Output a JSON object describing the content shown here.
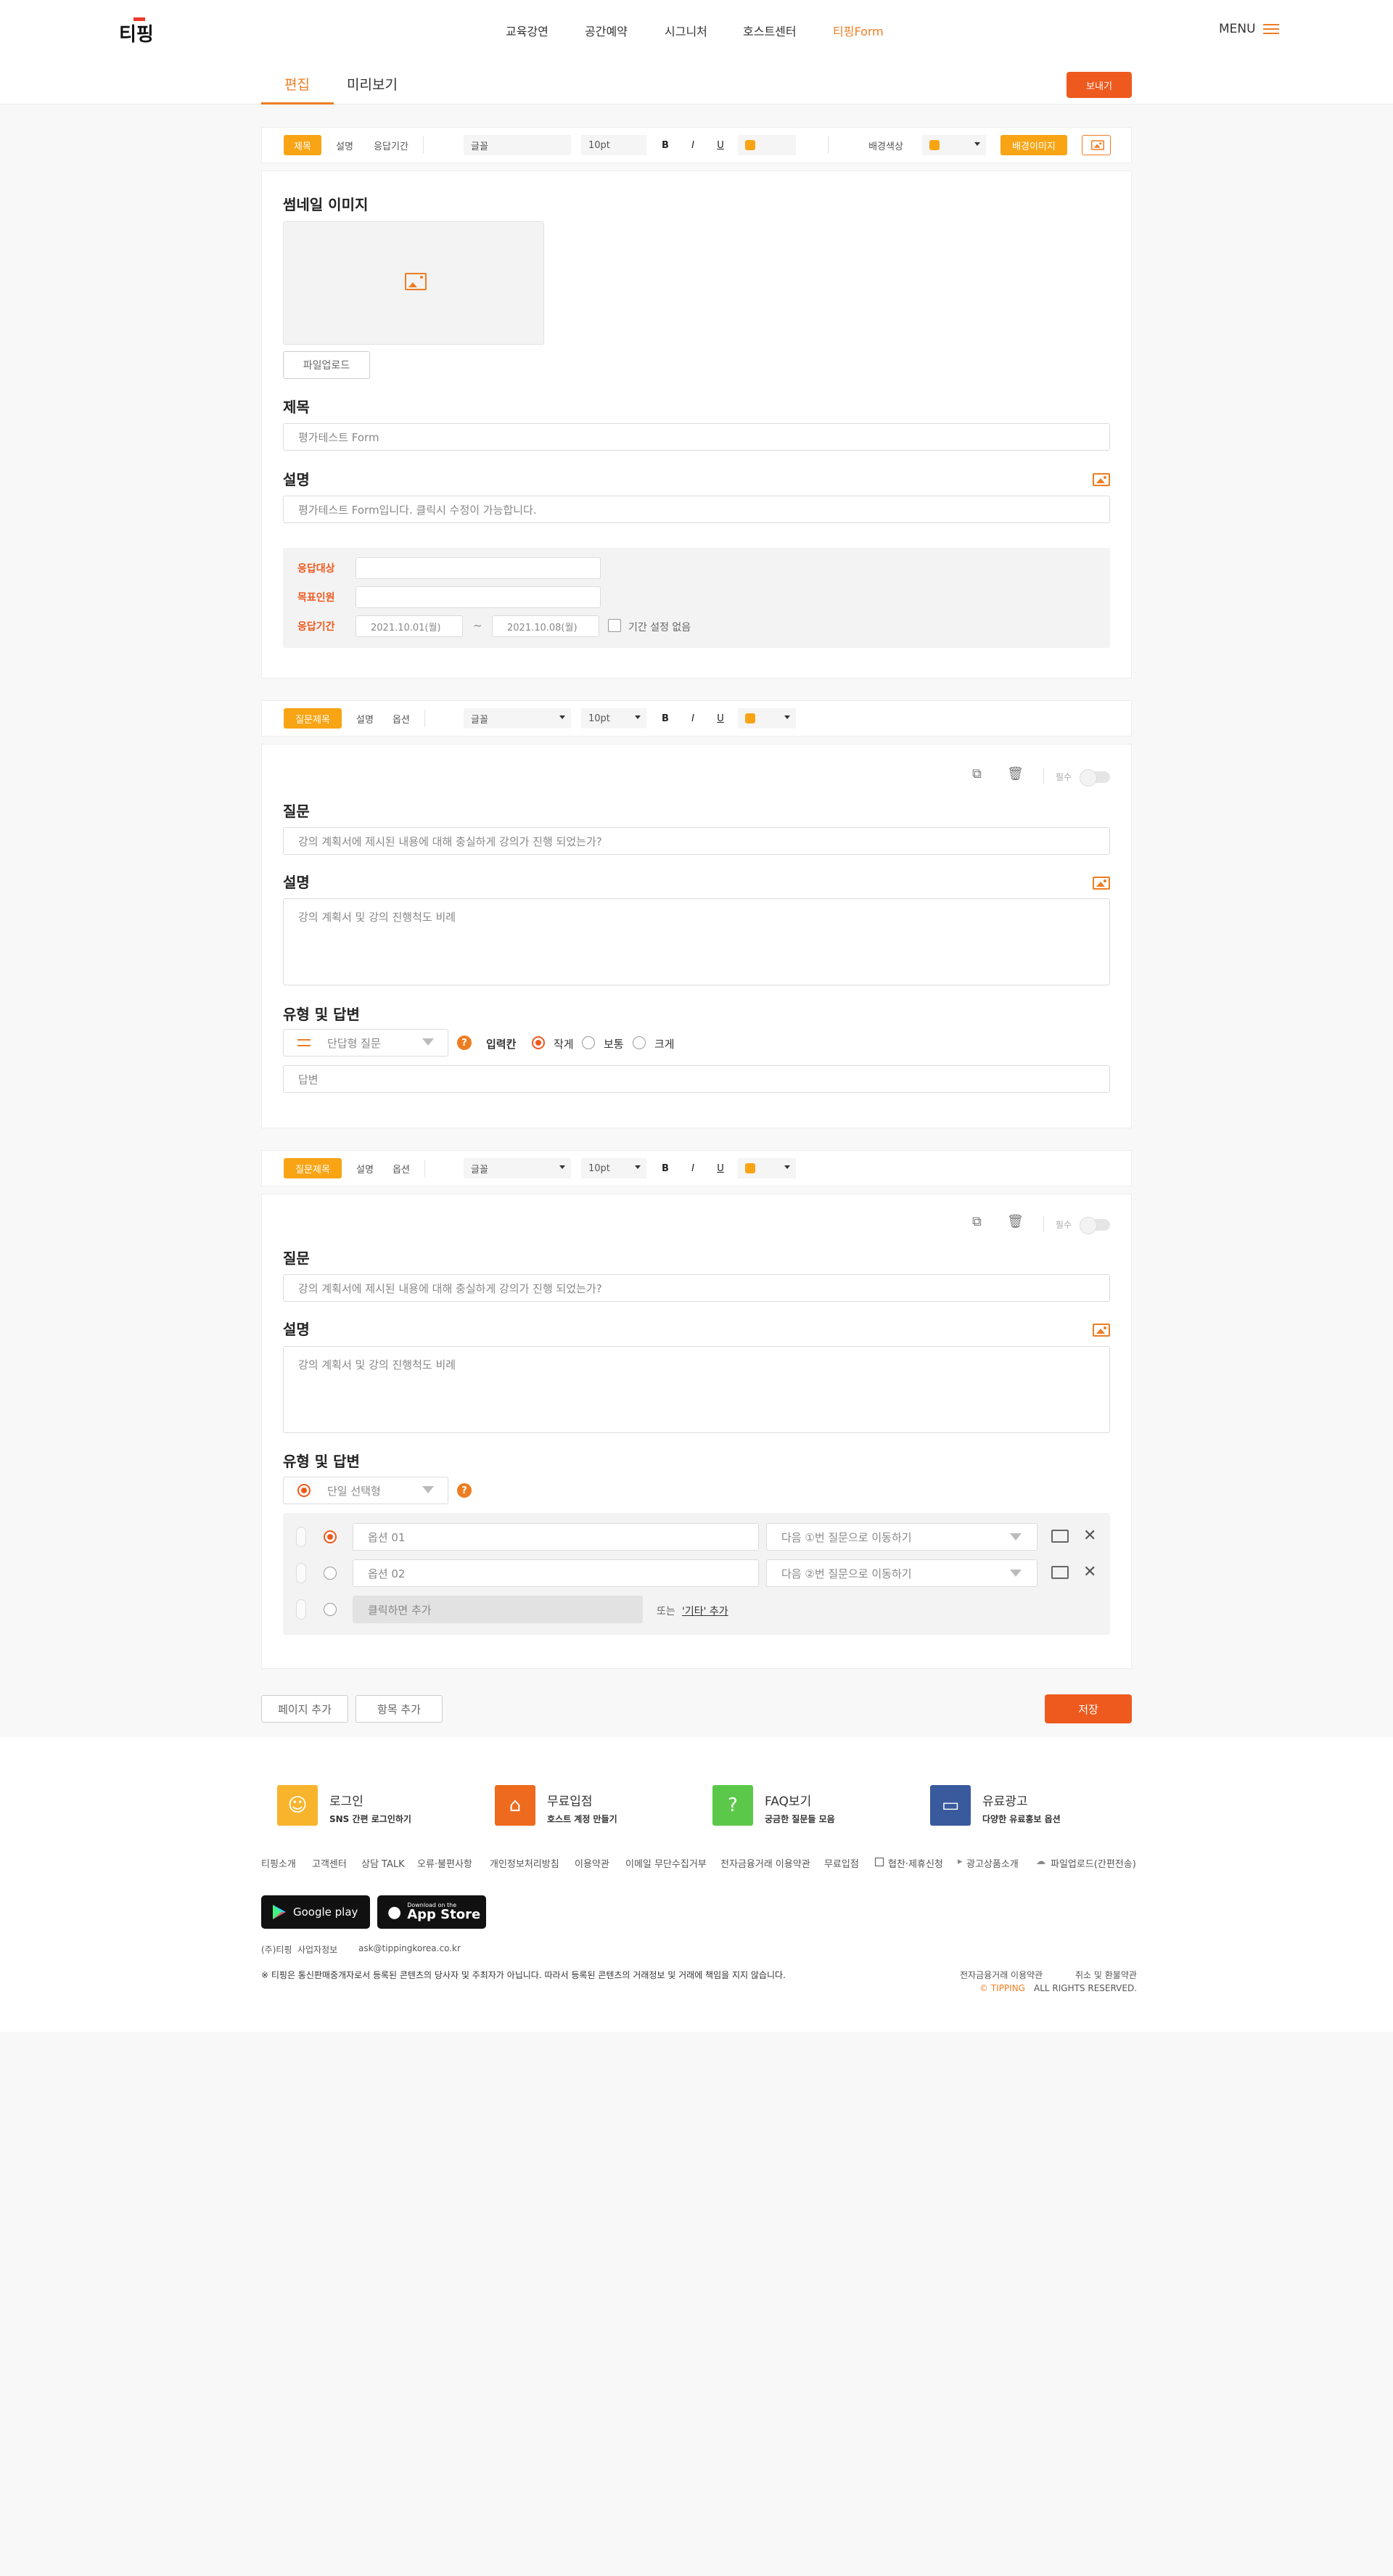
{
  "header": {
    "logo_text": "티핑",
    "nav": [
      "교육강연",
      "공간예약",
      "시그니처",
      "호스트센터",
      "티핑Form"
    ],
    "menu_label": "MENU"
  },
  "tabs": {
    "edit": "편집",
    "preview": "미리보기"
  },
  "send_button": "보내기",
  "form_toolbar": {
    "tabs": [
      "제목",
      "설명",
      "응답기간"
    ],
    "font": "글꼴",
    "size": "10pt",
    "bold": "B",
    "italic": "I",
    "underline": "U",
    "bg_color_label": "배경색상",
    "bg_image_button": "배경이미지"
  },
  "form_info": {
    "thumbnail_label": "썸네일 이미지",
    "upload_button": "파일업로드",
    "title_label": "제목",
    "title_value": "평가테스트 Form",
    "desc_label": "설명",
    "desc_value": "평가테스트 Form입니다. 클릭시 수정이 가능합니다.",
    "target_label": "응답대상",
    "goal_label": "목표인원",
    "period_label": "응답기간",
    "start_date": "2021.10.01(월)",
    "tilde": "~",
    "end_date": "2021.10.08(월)",
    "no_period_label": "기간 설정 없음"
  },
  "question_toolbar": {
    "tabs": [
      "질문제목",
      "설명",
      "옵션"
    ],
    "font": "글꼴",
    "size": "10pt",
    "bold": "B",
    "italic": "I",
    "underline": "U"
  },
  "question1": {
    "required_label": "필수",
    "question_label": "질문",
    "question_placeholder": "강의 계획서에 제시된 내용에 대해 충실하게 강의가 진행 되었는가?",
    "desc_label": "설명",
    "desc_placeholder": "강의 계획서 및 강의 진행척도 비례",
    "type_label": "유형 및 답변",
    "type_value": "단답형 질문",
    "input_label": "입력칸",
    "size_options": [
      "작게",
      "보통",
      "크게"
    ],
    "selected_size": "작게",
    "answer_placeholder": "답변"
  },
  "question2": {
    "required_label": "필수",
    "question_label": "질문",
    "question_placeholder": "강의 계획서에 제시된 내용에 대해 충실하게 강의가 진행 되었는가?",
    "desc_label": "설명",
    "desc_placeholder": "강의 계획서 및 강의 진행척도 비례",
    "type_label": "유형 및 답변",
    "type_value": "단일 선택형",
    "options": [
      {
        "label": "옵션 01",
        "goto": "다음 ①번 질문으로 이동하기",
        "selected": true
      },
      {
        "label": "옵션 02",
        "goto": "다음 ②번 질문으로 이동하기",
        "selected": false
      }
    ],
    "add_option_placeholder": "클릭하면 추가",
    "or_text": "또는",
    "add_other": "'기타' 추가"
  },
  "bottom_buttons": {
    "add_page": "페이지 추가",
    "add_item": "항목 추가",
    "save": "저장"
  },
  "footer": {
    "quick": [
      {
        "title": "로그인",
        "sub": "SNS 간편 로그인하기",
        "color": "#f8b42c"
      },
      {
        "title": "무료입점",
        "sub": "호스트 계정 만들기",
        "color": "#ee6a1e"
      },
      {
        "title": "FAQ보기",
        "sub": "궁금한 질문들 모음",
        "color": "#5cc84a"
      },
      {
        "title": "유료광고",
        "sub": "다양한 유료홍보 옵션",
        "color": "#3a5a9e"
      }
    ],
    "links": [
      "티핑소개",
      "고객센터",
      "상담 TALK",
      "오류·불편사항",
      "개인정보처리방침",
      "이용약관",
      "이메일 무단수집거부",
      "전자금융거래 이용약관",
      "무료입점",
      "협찬·제휴신청",
      "광고상품소개",
      "파일업로드(간편전송)"
    ],
    "google_play": "Google play",
    "app_store_small": "Download on the",
    "app_store": "App Store",
    "company": "(주)티핑",
    "biz_info": "사업자정보",
    "email": "ask@tippingkorea.co.kr",
    "notice": "※ 티핑은 통신판매중개자로서 등록된 콘텐츠의 당사자 및 주최자가 아닙니다. 따라서 등록된 콘텐츠의 거래정보 및 거래에 책임을 지지 않습니다.",
    "terms1": "전자금융거래 이용약관",
    "terms2": "취소 및 환불약관",
    "copyright_brand": "© TIPPING",
    "copyright_rest": "ALL RIGHTS RESERVED."
  }
}
